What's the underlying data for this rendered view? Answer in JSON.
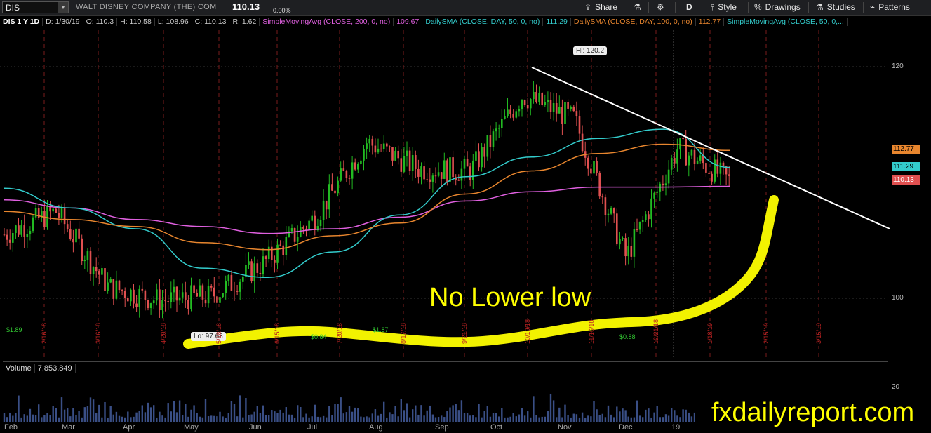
{
  "toolbar": {
    "symbol": "DIS",
    "company": "WALT DISNEY COMPANY (THE) COM",
    "price": "110.13",
    "change_pct": "0.00%",
    "share": "Share",
    "period": "D",
    "style": "Style",
    "drawings": "Drawings",
    "studies": "Studies",
    "patterns": "Patterns"
  },
  "infobar": {
    "symbol_period": "DIS 1 Y 1D",
    "date": "D: 1/30/19",
    "open": "O: 110.3",
    "high": "H: 110.58",
    "low": "L: 108.96",
    "close": "C: 110.13",
    "range": "R: 1.62",
    "study1": "SimpleMovingAvg (CLOSE, 200, 0, no)",
    "study1_val": "109.67",
    "study2": "DailySMA (CLOSE, DAY, 50, 0, no)",
    "study2_val": "111.29",
    "study3": "DailySMA (CLOSE, DAY, 100, 0, no)",
    "study3_val": "112.77",
    "study4": "SimpleMovingAvg (CLOSE, 50, 0,..."
  },
  "colors": {
    "sma200": "#e060e0",
    "sma50": "#33cccc",
    "sma100": "#e8862e",
    "up": "#22bb22",
    "down": "#e05050",
    "annotation": "#ffff00"
  },
  "price_tags": [
    "112.77",
    "111.29",
    "110.13"
  ],
  "y_ticks": [
    "120",
    "100"
  ],
  "vol_ticks": [
    "20"
  ],
  "hi_label": "Hi: 120.2",
  "lo_label": "Lo: 97.68",
  "events": {
    "div1": "$1.89",
    "div2": "$0.84",
    "div3": "$1.87",
    "div4": "$0.88"
  },
  "date_marks": [
    "2/16/18",
    "3/16/18",
    "4/20/18",
    "5/18/18",
    "6/15/18",
    "7/20/18",
    "8/17/18",
    "9/21/18",
    "10/19/18",
    "11/16/18",
    "12/21/18",
    "1/18/19",
    "2/15/19",
    "3/15/19"
  ],
  "volume": {
    "label": "Volume",
    "value": "7,853,849"
  },
  "months": [
    "Feb",
    "Mar",
    "Apr",
    "May",
    "Jun",
    "Jul",
    "Aug",
    "Sep",
    "Oct",
    "Nov",
    "Dec",
    "19"
  ],
  "annotation": "No Lower low",
  "watermark": "fxdailyreport.com",
  "chart_data": {
    "type": "line",
    "title": "DIS 1 Y 1D",
    "ylim": [
      95,
      123
    ],
    "x": [
      "2018-02",
      "2018-03",
      "2018-04",
      "2018-05",
      "2018-06",
      "2018-07",
      "2018-08",
      "2018-09",
      "2018-10",
      "2018-11",
      "2018-12",
      "2019-01"
    ],
    "series": [
      {
        "name": "SimpleMovingAvg (CLOSE, 200, 0, no)",
        "values": [
          108.5,
          107.8,
          106.8,
          106.2,
          105.6,
          106.0,
          107.0,
          108.4,
          109.2,
          109.6,
          109.6,
          109.67
        ]
      },
      {
        "name": "DailySMA (CLOSE, DAY, 50, 0, no)",
        "values": [
          109.5,
          107.8,
          106.0,
          102.6,
          101.8,
          104.0,
          107.2,
          110.5,
          112.2,
          113.8,
          114.6,
          111.29
        ]
      },
      {
        "name": "DailySMA (CLOSE, DAY, 100, 0, no)",
        "values": [
          107.5,
          106.8,
          106.2,
          104.8,
          104.2,
          105.4,
          106.5,
          109.0,
          111.0,
          112.5,
          113.3,
          112.77
        ]
      }
    ],
    "price_path": [
      105.5,
      107.5,
      101.0,
      99.8,
      100.2,
      103.0,
      107.0,
      113.5,
      111.2,
      111.0,
      117.5,
      115.5,
      103.5,
      113.0,
      110.13
    ]
  }
}
